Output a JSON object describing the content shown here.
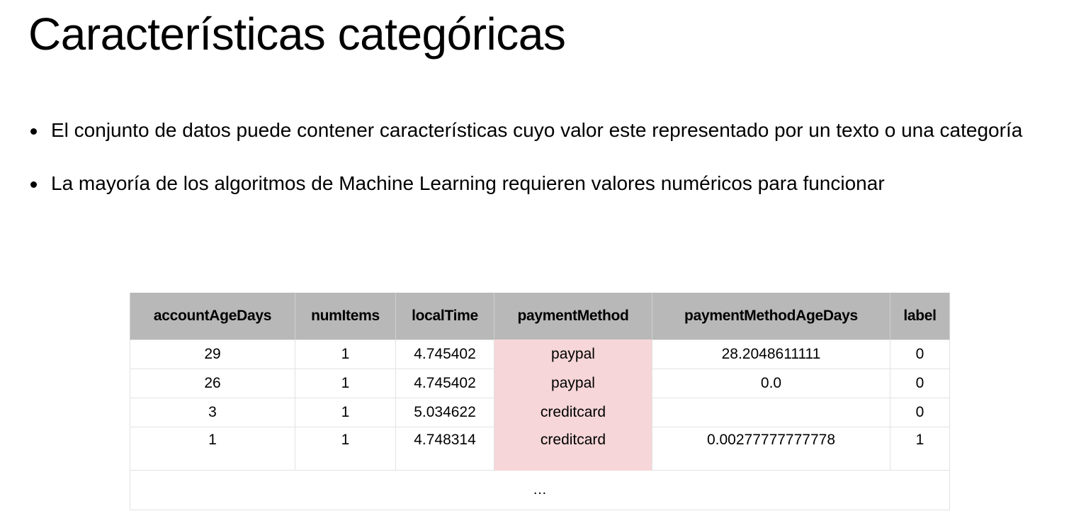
{
  "title": "Características categóricas",
  "bullets": [
    "El conjunto de datos puede contener características cuyo valor este representado por un texto o una categoría",
    "La mayoría de los algoritmos de Machine Learning requieren valores numéricos para funcionar"
  ],
  "table": {
    "columns": [
      "accountAgeDays",
      "numItems",
      "localTime",
      "paymentMethod",
      "paymentMethodAgeDays",
      "label"
    ],
    "highlight_column": "paymentMethod",
    "highlight_color": "#f6d6d8",
    "header_color": "#b8b8b8",
    "rows": [
      [
        "29",
        "1",
        "4.745402",
        "paypal",
        "28.2048611111",
        "0"
      ],
      [
        "26",
        "1",
        "4.745402",
        "paypal",
        "0.0",
        "0"
      ],
      [
        "3",
        "1",
        "5.034622",
        "creditcard",
        "",
        "0"
      ],
      [
        "1",
        "1",
        "4.748314",
        "creditcard",
        "0.00277777777778",
        "1"
      ]
    ],
    "ellipsis": "…"
  }
}
